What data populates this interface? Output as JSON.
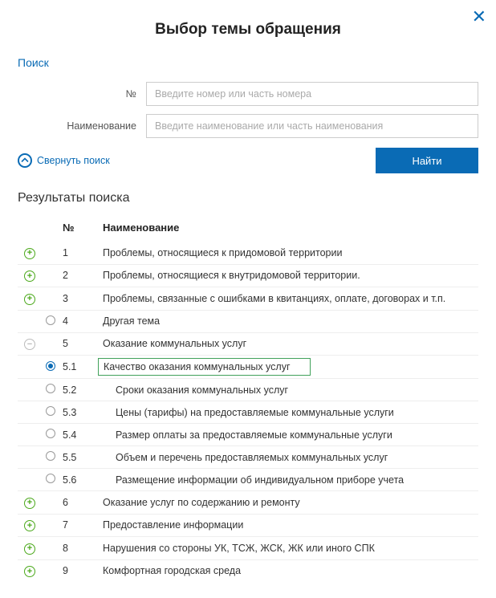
{
  "title": "Выбор темы обращения",
  "close_glyph": "✕",
  "search": {
    "label": "Поиск",
    "num_label": "№",
    "num_placeholder": "Введите номер или часть номера",
    "name_label": "Наименование",
    "name_placeholder": "Введите наименование или часть наименования",
    "collapse": "Свернуть поиск",
    "find": "Найти"
  },
  "results": {
    "heading": "Результаты поиска",
    "col_num": "№",
    "col_name": "Наименование",
    "rows": [
      {
        "icon": "plus",
        "radio": false,
        "selected": false,
        "num": "1",
        "name": "Проблемы, относящиеся к придомовой территории",
        "indent": false,
        "hi": false
      },
      {
        "icon": "plus",
        "radio": false,
        "selected": false,
        "num": "2",
        "name": "Проблемы, относящиеся к внутридомовой территории.",
        "indent": false,
        "hi": false
      },
      {
        "icon": "plus",
        "radio": false,
        "selected": false,
        "num": "3",
        "name": "Проблемы, связанные с ошибками в квитанциях, оплате, договорах и т.п.",
        "indent": false,
        "hi": false
      },
      {
        "icon": "",
        "radio": true,
        "selected": false,
        "num": "4",
        "name": "Другая тема",
        "indent": false,
        "hi": false
      },
      {
        "icon": "minus",
        "radio": false,
        "selected": false,
        "num": "5",
        "name": "Оказание коммунальных услуг",
        "indent": false,
        "hi": false
      },
      {
        "icon": "",
        "radio": true,
        "selected": true,
        "num": "5.1",
        "name": "Качество оказания коммунальных услуг",
        "indent": true,
        "hi": true
      },
      {
        "icon": "",
        "radio": true,
        "selected": false,
        "num": "5.2",
        "name": "Сроки оказания коммунальных услуг",
        "indent": true,
        "hi": false
      },
      {
        "icon": "",
        "radio": true,
        "selected": false,
        "num": "5.3",
        "name": "Цены (тарифы) на предоставляемые коммунальные услуги",
        "indent": true,
        "hi": false
      },
      {
        "icon": "",
        "radio": true,
        "selected": false,
        "num": "5.4",
        "name": "Размер оплаты за предоставляемые коммунальные услуги",
        "indent": true,
        "hi": false
      },
      {
        "icon": "",
        "radio": true,
        "selected": false,
        "num": "5.5",
        "name": "Объем и перечень предоставляемых коммунальных услуг",
        "indent": true,
        "hi": false
      },
      {
        "icon": "",
        "radio": true,
        "selected": false,
        "num": "5.6",
        "name": "Размещение информации об индивидуальном приборе учета",
        "indent": true,
        "hi": false
      },
      {
        "icon": "plus",
        "radio": false,
        "selected": false,
        "num": "6",
        "name": "Оказание услуг по содержанию и ремонту",
        "indent": false,
        "hi": false
      },
      {
        "icon": "plus",
        "radio": false,
        "selected": false,
        "num": "7",
        "name": "Предоставление информации",
        "indent": false,
        "hi": false
      },
      {
        "icon": "plus",
        "radio": false,
        "selected": false,
        "num": "8",
        "name": "Нарушения со стороны УК, ТСЖ, ЖСК, ЖК или иного СПК",
        "indent": false,
        "hi": false
      },
      {
        "icon": "plus",
        "radio": false,
        "selected": false,
        "num": "9",
        "name": "Комфортная городская среда",
        "indent": false,
        "hi": false
      }
    ]
  }
}
